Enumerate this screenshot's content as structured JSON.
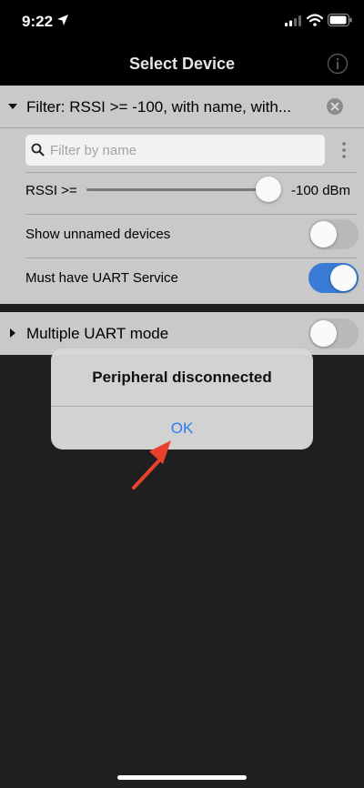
{
  "status_bar": {
    "time": "9:22"
  },
  "nav": {
    "title": "Select Device"
  },
  "filter": {
    "summary": "Filter: RSSI >= -100, with name, with...",
    "search_placeholder": "Filter by name",
    "rssi_label": "RSSI >=",
    "rssi_value_text": "-100 dBm",
    "rssi_slider_fraction": 0.93,
    "show_unnamed_label": "Show unnamed devices",
    "show_unnamed_on": false,
    "must_uart_label": "Must have UART Service",
    "must_uart_on": true
  },
  "multi_uart": {
    "label": "Multiple UART mode",
    "on": false
  },
  "alert": {
    "message": "Peripheral disconnected",
    "ok_label": "OK"
  },
  "colors": {
    "accent": "#3a7bd5",
    "link": "#2f7bf6",
    "annotation_arrow": "#e8412c"
  }
}
